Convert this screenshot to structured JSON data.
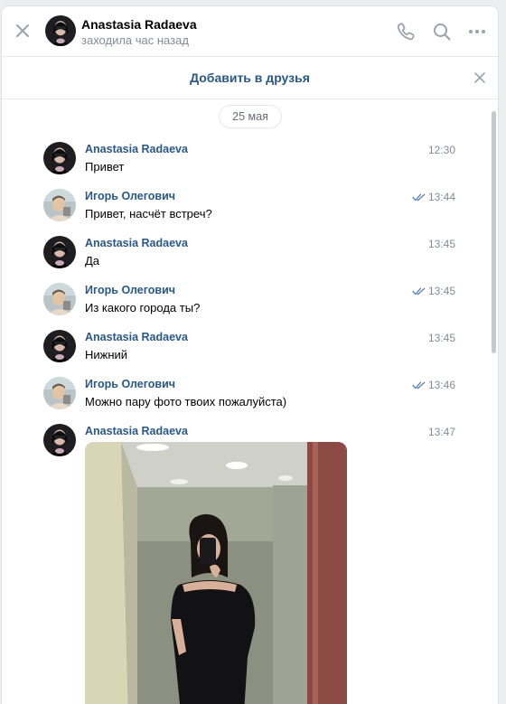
{
  "header": {
    "name": "Anastasia Radaeva",
    "status": "заходила час назад"
  },
  "banner": {
    "add_friend_label": "Добавить в друзья"
  },
  "date_divider": "25 мая",
  "messages": [
    {
      "author": "Anastasia Radaeva",
      "text": "Привет",
      "time": "12:30",
      "read": false
    },
    {
      "author": "Игорь Олегович",
      "text": "Привет, насчёт встреч?",
      "time": "13:44",
      "read": true
    },
    {
      "author": "Anastasia Radaeva",
      "text": "Да",
      "time": "13:45",
      "read": false
    },
    {
      "author": "Игорь Олегович",
      "text": "Из какого города ты?",
      "time": "13:45",
      "read": true
    },
    {
      "author": "Anastasia Radaeva",
      "text": "Нижний",
      "time": "13:45",
      "read": false
    },
    {
      "author": "Игорь Олегович",
      "text": "Можно пару фото твоих пожалуйста)",
      "time": "13:46",
      "read": true
    },
    {
      "author": "Anastasia Radaeva",
      "text": "",
      "time": "13:47",
      "read": false
    }
  ],
  "icons": {
    "close": "close-icon",
    "call": "phone-icon",
    "search": "search-icon",
    "more": "more-icon",
    "read": "double-check-icon"
  },
  "colors": {
    "accent_link": "#2a5885",
    "secondary_text": "#818c99",
    "read_check": "#5181b8"
  }
}
